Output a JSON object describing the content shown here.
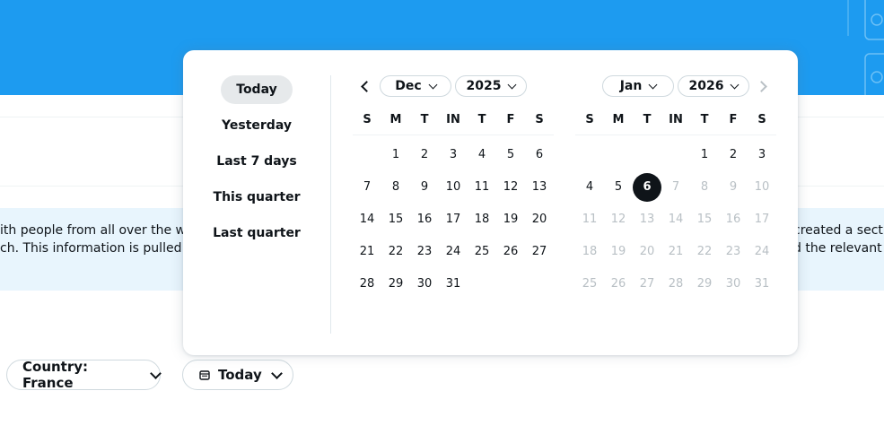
{
  "banner": {
    "left_line1": "ith people from all over the wo",
    "left_line2": "ch. This information is pulled f",
    "right_line1": "created a sect",
    "right_line2": "d the relevant t"
  },
  "filters": {
    "country_label": "Country: France",
    "date_label": "Today"
  },
  "picker": {
    "presets": [
      "Today",
      "Yesterday",
      "Last 7 days",
      "This quarter",
      "Last quarter"
    ],
    "active_preset": "Today",
    "left": {
      "month": "Dec",
      "year": "2025",
      "weekdays": [
        "S",
        "M",
        "T",
        "IN",
        "T",
        "F",
        "S"
      ],
      "weeks": [
        [
          "",
          "1",
          "2",
          "3",
          "4",
          "5",
          "6"
        ],
        [
          "7",
          "8",
          "9",
          "10",
          "11",
          "12",
          "13"
        ],
        [
          "14",
          "15",
          "16",
          "17",
          "18",
          "19",
          "20"
        ],
        [
          "21",
          "22",
          "23",
          "24",
          "25",
          "26",
          "27"
        ],
        [
          "28",
          "29",
          "30",
          "31",
          "",
          "",
          ""
        ]
      ]
    },
    "right": {
      "month": "Jan",
      "year": "2026",
      "weekdays": [
        "S",
        "M",
        "T",
        "IN",
        "T",
        "F",
        "S"
      ],
      "weeks": [
        [
          "",
          "",
          "",
          "",
          "1",
          "2",
          "3"
        ],
        [
          "4",
          "5",
          "6",
          "7",
          "8",
          "9",
          "10"
        ],
        [
          "11",
          "12",
          "13",
          "14",
          "15",
          "16",
          "17"
        ],
        [
          "18",
          "19",
          "20",
          "21",
          "22",
          "23",
          "24"
        ],
        [
          "25",
          "26",
          "27",
          "28",
          "29",
          "30",
          "31"
        ]
      ],
      "selected_day": "6",
      "last_enabled_day": 6
    }
  },
  "colors": {
    "brand_blue": "#1d9bf0",
    "banner_bg": "#e8f5fd",
    "selected_day_bg": "#0f1419",
    "disabled_day_text": "#b9c0c5"
  },
  "icons": {
    "prev_month": "chevron-left-icon",
    "next_month": "chevron-right-icon",
    "date_button": "calendar-icon",
    "dropdown": "chevron-down-icon"
  }
}
